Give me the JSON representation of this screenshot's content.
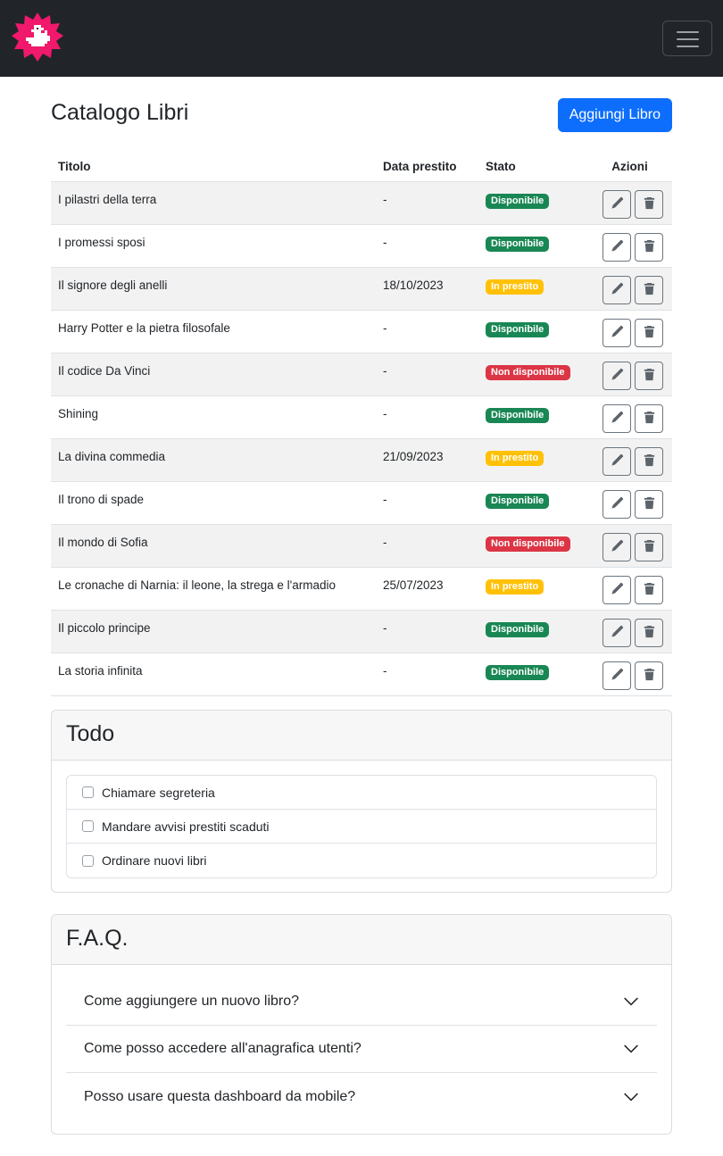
{
  "nav": {
    "logo": "duck-logo-icon",
    "menu_icon": "hamburger-icon"
  },
  "catalog": {
    "title": "Catalogo Libri",
    "add_button": "Aggiungi Libro",
    "columns": [
      "Titolo",
      "Data prestito",
      "Stato",
      "Azioni"
    ],
    "rows": [
      {
        "title": "I pilastri della terra",
        "date": "-",
        "status": "Disponibile",
        "status_kind": "ok"
      },
      {
        "title": "I promessi sposi",
        "date": "-",
        "status": "Disponibile",
        "status_kind": "ok"
      },
      {
        "title": "Il signore degli anelli",
        "date": "18/10/2023",
        "status": "In prestito",
        "status_kind": "loan"
      },
      {
        "title": "Harry Potter e la pietra filosofale",
        "date": "-",
        "status": "Disponibile",
        "status_kind": "ok"
      },
      {
        "title": "Il codice Da Vinci",
        "date": "-",
        "status": "Non disponibile",
        "status_kind": "no"
      },
      {
        "title": "Shining",
        "date": "-",
        "status": "Disponibile",
        "status_kind": "ok"
      },
      {
        "title": "La divina commedia",
        "date": "21/09/2023",
        "status": "In prestito",
        "status_kind": "loan"
      },
      {
        "title": "Il trono di spade",
        "date": "-",
        "status": "Disponibile",
        "status_kind": "ok"
      },
      {
        "title": "Il mondo di Sofia",
        "date": "-",
        "status": "Non disponibile",
        "status_kind": "no"
      },
      {
        "title": "Le cronache di Narnia: il leone, la strega e l'armadio",
        "date": "25/07/2023",
        "status": "In prestito",
        "status_kind": "loan"
      },
      {
        "title": "Il piccolo principe",
        "date": "-",
        "status": "Disponibile",
        "status_kind": "ok"
      },
      {
        "title": "La storia infinita",
        "date": "-",
        "status": "Disponibile",
        "status_kind": "ok"
      }
    ],
    "action_icons": [
      "pencil-icon",
      "trash-icon"
    ]
  },
  "todo": {
    "title": "Todo",
    "items": [
      {
        "label": "Chiamare segreteria",
        "checked": false
      },
      {
        "label": "Mandare avvisi prestiti scaduti",
        "checked": false
      },
      {
        "label": "Ordinare nuovi libri",
        "checked": false
      }
    ]
  },
  "faq": {
    "title": "F.A.Q.",
    "items": [
      "Come aggiungere un nuovo libro?",
      "Come posso accedere all'anagrafica utenti?",
      "Posso usare questa dashboard da mobile?"
    ],
    "expand_icon": "chevron-down-icon"
  },
  "colors": {
    "navbar": "#212529",
    "primary": "#0d6efd",
    "success": "#198754",
    "warning": "#ffc107",
    "danger": "#dc3545",
    "logo": "#f0196b"
  }
}
